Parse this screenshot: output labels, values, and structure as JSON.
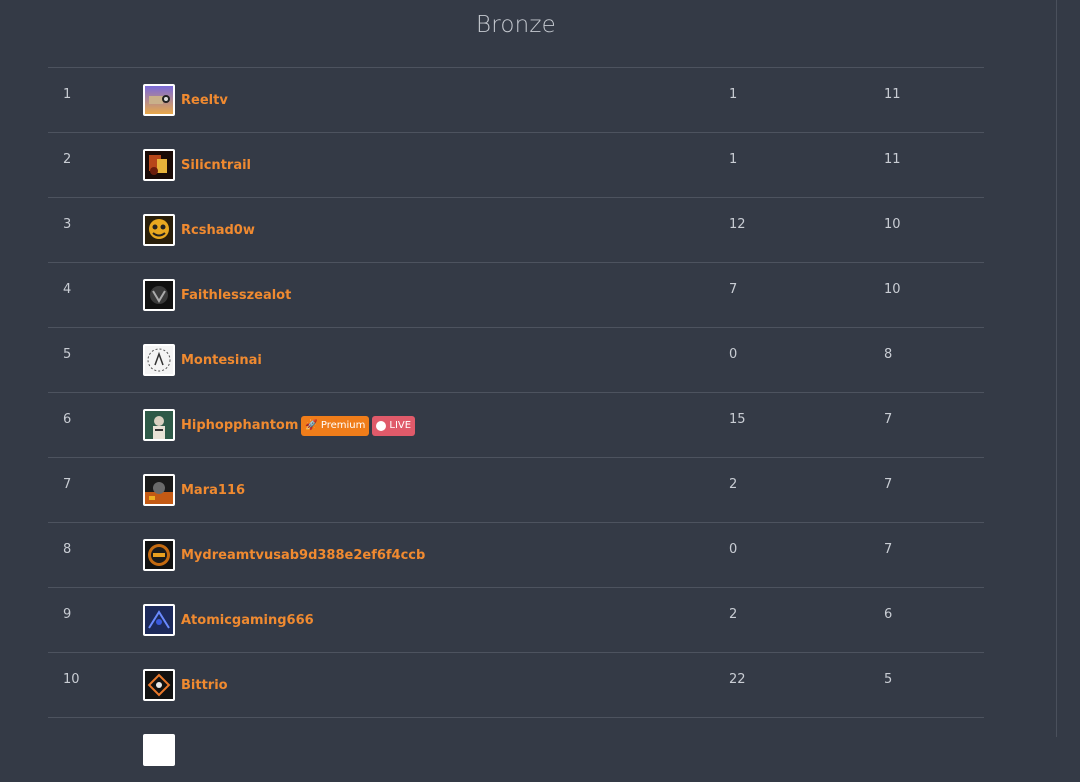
{
  "title": "Bronze",
  "rows": [
    {
      "rank": "1",
      "username": "Reeltv",
      "col_a": "1",
      "col_b": "11",
      "avatar_icon": "reeltv-avatar-icon"
    },
    {
      "rank": "2",
      "username": "Silicntrail",
      "col_a": "1",
      "col_b": "11",
      "avatar_icon": "silicntrail-avatar-icon"
    },
    {
      "rank": "3",
      "username": "Rcshad0w",
      "col_a": "12",
      "col_b": "10",
      "avatar_icon": "rcshad0w-avatar-icon"
    },
    {
      "rank": "4",
      "username": "Faithlesszealot",
      "col_a": "7",
      "col_b": "10",
      "avatar_icon": "faithlesszealot-avatar-icon"
    },
    {
      "rank": "5",
      "username": "Montesinai",
      "col_a": "0",
      "col_b": "8",
      "avatar_icon": "montesinai-avatar-icon"
    },
    {
      "rank": "6",
      "username": "Hiphopphantom",
      "col_a": "15",
      "col_b": "7",
      "avatar_icon": "hiphopphantom-avatar-icon",
      "badges": {
        "premium": "Premium",
        "live": "LIVE"
      }
    },
    {
      "rank": "7",
      "username": "Mara116",
      "col_a": "2",
      "col_b": "7",
      "avatar_icon": "mara116-avatar-icon"
    },
    {
      "rank": "8",
      "username": "Mydreamtvusab9d388e2ef6f4ccb",
      "col_a": "0",
      "col_b": "7",
      "avatar_icon": "mydreamtv-avatar-icon"
    },
    {
      "rank": "9",
      "username": "Atomicgaming666",
      "col_a": "2",
      "col_b": "6",
      "avatar_icon": "atomicgaming-avatar-icon"
    },
    {
      "rank": "10",
      "username": "Bittrio",
      "col_a": "22",
      "col_b": "5",
      "avatar_icon": "bittrio-avatar-icon"
    }
  ],
  "colors": {
    "background": "#343a46",
    "username": "#f08a30",
    "premium_badge": "#f07d1a",
    "live_badge": "#e05a6a",
    "divider": "#4d535f"
  }
}
